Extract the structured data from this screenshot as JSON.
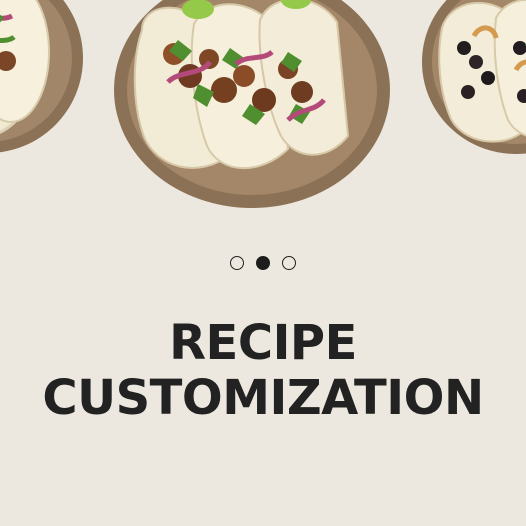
{
  "carousel": {
    "slides": [
      {
        "name": "tacos-plate-left",
        "alt": "tacos plate"
      },
      {
        "name": "tacos-plate-center",
        "alt": "tacos plate"
      },
      {
        "name": "tacos-plate-right",
        "alt": "black bean tacos plate"
      }
    ],
    "active_slide": 2,
    "dots": [
      "slide-1",
      "slide-2",
      "slide-3"
    ]
  },
  "headline": {
    "line1": "RECIPE",
    "line2": "CUSTOMIZATION"
  },
  "colors": {
    "background": "#ece8df",
    "text": "#222222",
    "plate": "#8b7156",
    "tortilla": "#f1e9d2",
    "cilantro": "#4f8f2f",
    "onion": "#b44a7a"
  }
}
